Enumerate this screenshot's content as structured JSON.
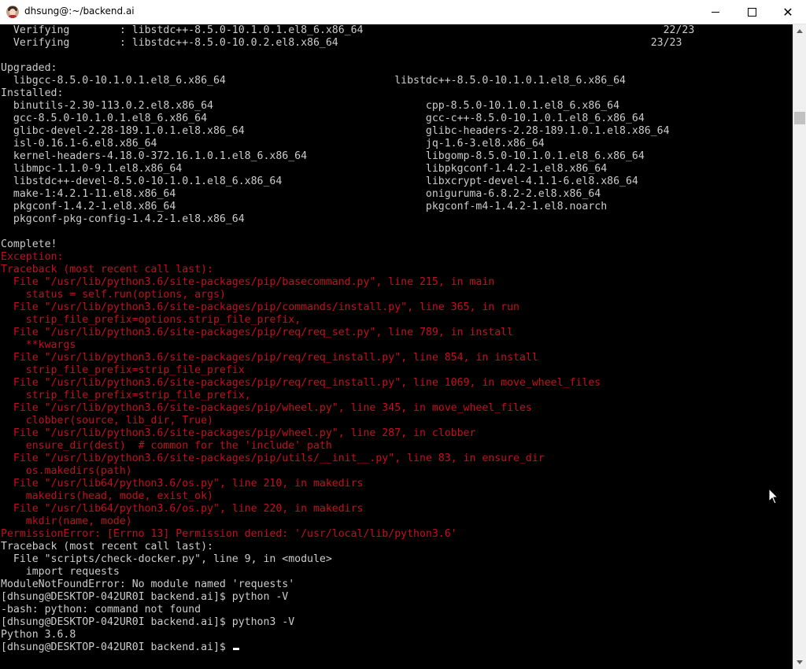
{
  "window": {
    "title": "dhsung@:~/backend.ai",
    "minimize_glyph": "",
    "maximize_glyph": "",
    "close_glyph": "✕"
  },
  "colors": {
    "error": "#c50f1f",
    "normal": "#cccccc",
    "background": "#000000"
  },
  "terminal": {
    "lines": [
      {
        "text": "  Verifying        : libstdc++-8.5.0-10.1.0.1.el8_6.x86_64                                                22/23",
        "style": "out"
      },
      {
        "text": "  Verifying        : libstdc++-8.5.0-10.0.2.el8.x86_64                                                  23/23",
        "style": "out"
      },
      {
        "text": "",
        "style": "out"
      },
      {
        "text": "Upgraded:",
        "style": "out"
      },
      {
        "text": "  libgcc-8.5.0-10.1.0.1.el8_6.x86_64                           libstdc++-8.5.0-10.1.0.1.el8_6.x86_64",
        "style": "out"
      },
      {
        "text": "Installed:",
        "style": "out"
      },
      {
        "text": "  binutils-2.30-113.0.2.el8.x86_64                                  cpp-8.5.0-10.1.0.1.el8_6.x86_64",
        "style": "out"
      },
      {
        "text": "  gcc-8.5.0-10.1.0.1.el8_6.x86_64                                   gcc-c++-8.5.0-10.1.0.1.el8_6.x86_64",
        "style": "out"
      },
      {
        "text": "  glibc-devel-2.28-189.1.0.1.el8.x86_64                             glibc-headers-2.28-189.1.0.1.el8.x86_64",
        "style": "out"
      },
      {
        "text": "  isl-0.16.1-6.el8.x86_64                                           jq-1.6-3.el8.x86_64",
        "style": "out"
      },
      {
        "text": "  kernel-headers-4.18.0-372.16.1.0.1.el8_6.x86_64                   libgomp-8.5.0-10.1.0.1.el8_6.x86_64",
        "style": "out"
      },
      {
        "text": "  libmpc-1.1.0-9.1.el8.x86_64                                       libpkgconf-1.4.2-1.el8.x86_64",
        "style": "out"
      },
      {
        "text": "  libstdc++-devel-8.5.0-10.1.0.1.el8_6.x86_64                       libxcrypt-devel-4.1.1-6.el8.x86_64",
        "style": "out"
      },
      {
        "text": "  make-1:4.2.1-11.el8.x86_64                                        oniguruma-6.8.2-2.el8.x86_64",
        "style": "out"
      },
      {
        "text": "  pkgconf-1.4.2-1.el8.x86_64                                        pkgconf-m4-1.4.2-1.el8.noarch",
        "style": "out"
      },
      {
        "text": "  pkgconf-pkg-config-1.4.2-1.el8.x86_64",
        "style": "out"
      },
      {
        "text": "",
        "style": "out"
      },
      {
        "text": "Complete!",
        "style": "out"
      },
      {
        "text": "Exception:",
        "style": "err"
      },
      {
        "text": "Traceback (most recent call last):",
        "style": "err"
      },
      {
        "text": "  File \"/usr/lib/python3.6/site-packages/pip/basecommand.py\", line 215, in main",
        "style": "err"
      },
      {
        "text": "    status = self.run(options, args)",
        "style": "err"
      },
      {
        "text": "  File \"/usr/lib/python3.6/site-packages/pip/commands/install.py\", line 365, in run",
        "style": "err"
      },
      {
        "text": "    strip_file_prefix=options.strip_file_prefix,",
        "style": "err"
      },
      {
        "text": "  File \"/usr/lib/python3.6/site-packages/pip/req/req_set.py\", line 789, in install",
        "style": "err"
      },
      {
        "text": "    **kwargs",
        "style": "err"
      },
      {
        "text": "  File \"/usr/lib/python3.6/site-packages/pip/req/req_install.py\", line 854, in install",
        "style": "err"
      },
      {
        "text": "    strip_file_prefix=strip_file_prefix",
        "style": "err"
      },
      {
        "text": "  File \"/usr/lib/python3.6/site-packages/pip/req/req_install.py\", line 1069, in move_wheel_files",
        "style": "err"
      },
      {
        "text": "    strip_file_prefix=strip_file_prefix,",
        "style": "err"
      },
      {
        "text": "  File \"/usr/lib/python3.6/site-packages/pip/wheel.py\", line 345, in move_wheel_files",
        "style": "err"
      },
      {
        "text": "    clobber(source, lib_dir, True)",
        "style": "err"
      },
      {
        "text": "  File \"/usr/lib/python3.6/site-packages/pip/wheel.py\", line 287, in clobber",
        "style": "err"
      },
      {
        "text": "    ensure_dir(dest)  # common for the 'include' path",
        "style": "err"
      },
      {
        "text": "  File \"/usr/lib/python3.6/site-packages/pip/utils/__init__.py\", line 83, in ensure_dir",
        "style": "err"
      },
      {
        "text": "    os.makedirs(path)",
        "style": "err"
      },
      {
        "text": "  File \"/usr/lib64/python3.6/os.py\", line 210, in makedirs",
        "style": "err"
      },
      {
        "text": "    makedirs(head, mode, exist_ok)",
        "style": "err"
      },
      {
        "text": "  File \"/usr/lib64/python3.6/os.py\", line 220, in makedirs",
        "style": "err"
      },
      {
        "text": "    mkdir(name, mode)",
        "style": "err"
      },
      {
        "text": "PermissionError: [Errno 13] Permission denied: '/usr/local/lib/python3.6'",
        "style": "err"
      },
      {
        "text": "Traceback (most recent call last):",
        "style": "out"
      },
      {
        "text": "  File \"scripts/check-docker.py\", line 9, in <module>",
        "style": "out"
      },
      {
        "text": "    import requests",
        "style": "out"
      },
      {
        "text": "ModuleNotFoundError: No module named 'requests'",
        "style": "out"
      },
      {
        "text": "[dhsung@DESKTOP-042UR0I backend.ai]$ python -V",
        "style": "out"
      },
      {
        "text": "-bash: python: command not found",
        "style": "out"
      },
      {
        "text": "[dhsung@DESKTOP-042UR0I backend.ai]$ python3 -V",
        "style": "out"
      },
      {
        "text": "Python 3.6.8",
        "style": "out"
      },
      {
        "text": "[dhsung@DESKTOP-042UR0I backend.ai]$ ",
        "style": "out",
        "cursor": true
      }
    ]
  },
  "icons": {
    "app": "user-avatar-icon",
    "minimize": "minimize-icon",
    "maximize": "maximize-icon",
    "close": "close-icon",
    "scroll_up": "scroll-up-arrow-icon",
    "scroll_down": "scroll-down-arrow-icon",
    "mouse": "mouse-pointer-icon"
  }
}
